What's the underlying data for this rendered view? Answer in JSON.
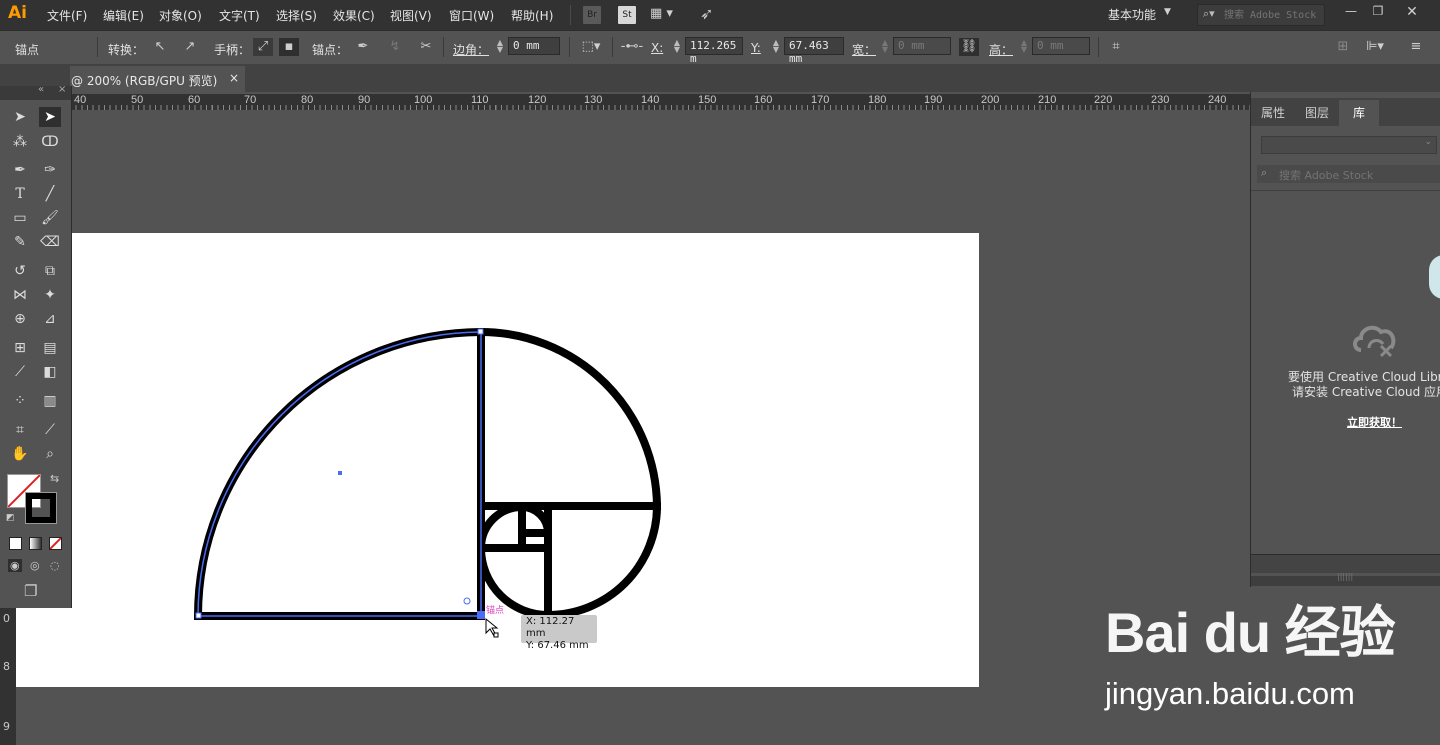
{
  "app": {
    "logo": "Ai"
  },
  "menu": [
    "文件(F)",
    "编辑(E)",
    "对象(O)",
    "文字(T)",
    "选择(S)",
    "效果(C)",
    "视图(V)",
    "窗口(W)",
    "帮助(H)"
  ],
  "menubar_icons": {
    "bridge": "Br",
    "stock": "St"
  },
  "workspace": {
    "label": "基本功能",
    "search_placeholder": "搜索 Adobe Stock"
  },
  "control": {
    "anchor_label": "锚点",
    "convert_label": "转换：",
    "handle_label": "手柄：",
    "anchor2_label": "锚点：",
    "corner_label": "边角：",
    "corner_value": "0 mm",
    "x_label": "X:",
    "x_value": "112.265 m",
    "y_label": "Y:",
    "y_value": "67.463 mm",
    "w_label": "宽：",
    "w_value": "0 mm",
    "h_label": "高：",
    "h_value": "0 mm"
  },
  "document": {
    "tab_label": "@ 200% (RGB/GPU 预览)",
    "close": "×"
  },
  "ruler": {
    "labels": [
      "40",
      "50",
      "60",
      "70",
      "80",
      "90",
      "100",
      "110",
      "120",
      "130",
      "140",
      "150",
      "160",
      "170",
      "180",
      "190",
      "200",
      "210",
      "220",
      "230",
      "240"
    ]
  },
  "vruler": {
    "labels": [
      "0",
      "8",
      "9"
    ]
  },
  "libraries": {
    "tabs": [
      "属性",
      "图层",
      "库"
    ],
    "search_placeholder": "搜索 Adobe Stock",
    "message_line1_prefix": "要使用 ",
    "message_line1_brand": "Creative Cloud Librari",
    "message_line2_prefix": "请安装 ",
    "message_line2_brand": "Creative Cloud 应用程",
    "link": "立即获取！"
  },
  "canvas": {
    "anchor_tag": "锚点",
    "readout_x": "X: 112.27 mm",
    "readout_y": "Y: 67.46 mm"
  },
  "watermark": {
    "logo": "Bai du 经验",
    "url": "jingyan.baidu.com"
  },
  "colors": {
    "selection": "#4a6cf7",
    "anchor_tag": "#e040c0",
    "accent": "#ff9a00"
  }
}
